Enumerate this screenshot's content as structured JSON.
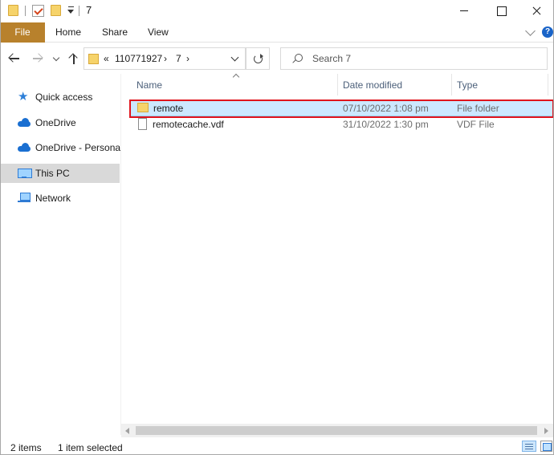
{
  "titlebar": {
    "title": "7"
  },
  "ribbon": {
    "tabs": [
      "File",
      "Home",
      "Share",
      "View"
    ],
    "help": "?"
  },
  "address": {
    "overflow": "«",
    "crumbs": [
      "110771927",
      "7"
    ],
    "separator": "›"
  },
  "search": {
    "placeholder": "Search 7"
  },
  "navpane": {
    "items": [
      {
        "label": "Quick access",
        "icon": "star-icon"
      },
      {
        "label": "OneDrive",
        "icon": "cloud-icon"
      },
      {
        "label": "OneDrive - Personal",
        "icon": "cloud-icon"
      },
      {
        "label": "This PC",
        "icon": "pc-icon",
        "selected": true
      },
      {
        "label": "Network",
        "icon": "network-icon"
      }
    ]
  },
  "columns": {
    "name": "Name",
    "date": "Date modified",
    "type": "Type"
  },
  "files": [
    {
      "name": "remote",
      "date": "07/10/2022 1:08 pm",
      "type": "File folder",
      "icon": "folder-icon",
      "selected": true
    },
    {
      "name": "remotecache.vdf",
      "date": "31/10/2022 1:30 pm",
      "type": "VDF File",
      "icon": "file-icon",
      "selected": false
    }
  ],
  "status": {
    "count": "2 items",
    "selection": "1 item selected"
  },
  "colors": {
    "file_tab": "#b8812c",
    "selection": "#cce8ff",
    "highlight_border": "#e0141c",
    "folder": "#f6d36a"
  }
}
